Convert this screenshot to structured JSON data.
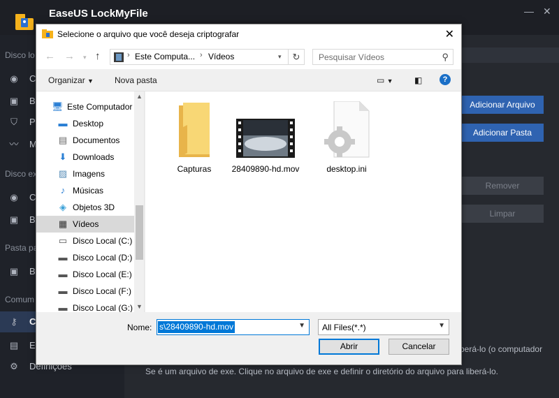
{
  "app": {
    "name": "EaseUS LockMyFile",
    "sidebar": {
      "sections": [
        "Disco lo",
        "Disco ex",
        "Pasta pa",
        "Comum"
      ],
      "items": [
        "C",
        "B",
        "P",
        "M",
        "C",
        "B",
        "B",
        "C",
        "E",
        "Definições"
      ]
    },
    "buttons": {
      "add_file": "Adicionar Arquivo",
      "add_folder": "Adicionar Pasta",
      "remove": "Remover",
      "clear": "Limpar"
    },
    "help_text_1": "berá-lo (o computador",
    "help_text_2": "Se é um arquivo de exe. Clique no arquivo de exe e definir o diretório do arquivo para liberá-lo."
  },
  "dialog": {
    "title": "Selecione o arquivo que você deseja criptografar",
    "address": {
      "segments": [
        "Este Computa...",
        "Vídeos"
      ]
    },
    "search_placeholder": "Pesquisar Vídeos",
    "toolbar": {
      "organize": "Organizar",
      "new_folder": "Nova pasta"
    },
    "nav": [
      {
        "label": "Este Computador",
        "icon": "computer-icon"
      },
      {
        "label": "Desktop",
        "icon": "desktop-icon"
      },
      {
        "label": "Documentos",
        "icon": "documents-icon"
      },
      {
        "label": "Downloads",
        "icon": "downloads-icon"
      },
      {
        "label": "Imagens",
        "icon": "pictures-icon"
      },
      {
        "label": "Músicas",
        "icon": "music-icon"
      },
      {
        "label": "Objetos 3D",
        "icon": "objects3d-icon"
      },
      {
        "label": "Vídeos",
        "icon": "videos-icon",
        "selected": true
      },
      {
        "label": "Disco Local (C:)",
        "icon": "drive-icon"
      },
      {
        "label": "Disco Local (D:)",
        "icon": "drive-icon"
      },
      {
        "label": "Disco Local (E:)",
        "icon": "drive-icon"
      },
      {
        "label": "Disco Local (F:)",
        "icon": "drive-icon"
      },
      {
        "label": "Disco Local (G:)",
        "icon": "drive-icon"
      }
    ],
    "files": [
      {
        "name": "Capturas",
        "type": "folder"
      },
      {
        "name": "28409890-hd.mov",
        "type": "video"
      },
      {
        "name": "desktop.ini",
        "type": "settings-file"
      }
    ],
    "filename_label": "Nome:",
    "filename_value": "s\\28409890-hd.mov",
    "filetype_value": "All Files(*.*)",
    "open_label": "Abrir",
    "cancel_label": "Cancelar"
  }
}
